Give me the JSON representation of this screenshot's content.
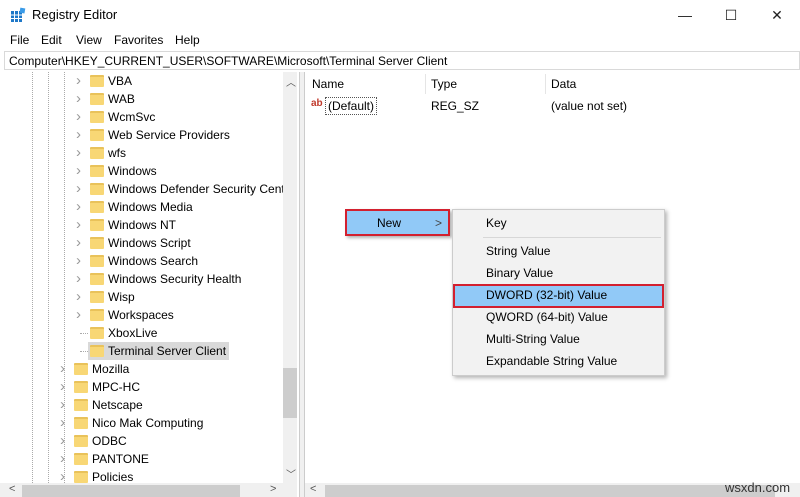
{
  "window": {
    "title": "Registry Editor",
    "minimize": "—",
    "maximize": "☐",
    "close": "✕"
  },
  "menu": [
    "File",
    "Edit",
    "View",
    "Favorites",
    "Help"
  ],
  "address": "Computer\\HKEY_CURRENT_USER\\SOFTWARE\\Microsoft\\Terminal Server Client",
  "tree": {
    "sub_items": [
      "VBA",
      "WAB",
      "WcmSvc",
      "Web Service Providers",
      "wfs",
      "Windows",
      "Windows Defender Security Cent",
      "Windows Media",
      "Windows NT",
      "Windows Script",
      "Windows Search",
      "Windows Security Health",
      "Wisp",
      "Workspaces",
      "XboxLive",
      "Terminal Server Client"
    ],
    "selected": "Terminal Server Client",
    "top_items": [
      "Mozilla",
      "MPC-HC",
      "Netscape",
      "Nico Mak Computing",
      "ODBC",
      "PANTONE",
      "Policies"
    ]
  },
  "values": {
    "columns": [
      "Name",
      "Type",
      "Data"
    ],
    "rows": [
      {
        "name": "(Default)",
        "type": "REG_SZ",
        "data": "(value not set)",
        "icon": "string-value-icon"
      }
    ]
  },
  "context_menu": {
    "new_label": "New",
    "arrow": ">"
  },
  "submenu": {
    "items": [
      "Key",
      "String Value",
      "Binary Value",
      "DWORD (32-bit) Value",
      "QWORD (64-bit) Value",
      "Multi-String Value",
      "Expandable String Value"
    ],
    "highlighted": "DWORD (32-bit) Value"
  },
  "colors": {
    "highlight": "#91c9f7",
    "annotation_border": "#d3202f",
    "folder": "#f8d775"
  },
  "watermark": "wsxdn.com"
}
